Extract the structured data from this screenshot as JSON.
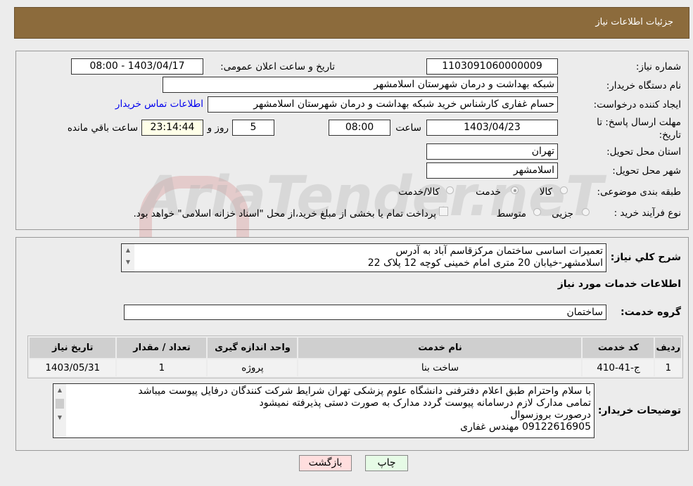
{
  "header": {
    "title": "جزئیات اطلاعات نیاز"
  },
  "form": {
    "need_number_label": "شماره نیاز:",
    "need_number": "1103091060000009",
    "announce_label": "تاریخ و ساعت اعلان عمومی:",
    "announce_value": "1403/04/17 - 08:00",
    "buyer_label": "نام دستگاه خریدار:",
    "buyer_value": "شبکه بهداشت و درمان شهرستان اسلامشهر",
    "creator_label": "ایجاد کننده درخواست:",
    "creator_value": "حسام غفاری کارشناس خرید شبکه بهداشت و درمان شهرستان اسلامشهر",
    "contact_link": "اطلاعات تماس خریدار",
    "deadline_label": "مهلت ارسال پاسخ: تا تاریخ:",
    "deadline_date": "1403/04/23",
    "time_label": "ساعت",
    "deadline_time": "08:00",
    "days": "5",
    "days_label": "روز و",
    "remaining": "23:14:44",
    "remaining_label": "ساعت باقي مانده",
    "province_label": "استان محل تحویل:",
    "province": "تهران",
    "city_label": "شهر محل تحویل:",
    "city": "اسلامشهر",
    "category_label": "طبقه بندی موضوعی:",
    "category_options": [
      "کالا",
      "خدمت",
      "کالا/خدمت"
    ],
    "category_selected": "خدمت",
    "process_label": "نوع فرآیند خرید :",
    "process_options": [
      "جزیی",
      "متوسط"
    ],
    "payment_note": "پرداخت تمام یا بخشی از مبلغ خرید،از محل \"اسناد خزانه اسلامی\" خواهد بود."
  },
  "details": {
    "summary_label": "شرح کلي نیاز:",
    "summary_lines": [
      "تعمیرات اساسی ساختمان مرکزقاسم آباد به آدرس",
      "اسلامشهر-خیابان 20 متری امام خمینی کوچه 12 پلاک 22"
    ],
    "services_title": "اطلاعات خدمات مورد نیاز",
    "group_label": "گروه خدمت:",
    "group_value": "ساختمان",
    "table": {
      "headers": [
        "ردیف",
        "کد خدمت",
        "نام خدمت",
        "واحد اندازه گیری",
        "تعداد / مقدار",
        "تاریخ نیاز"
      ],
      "rows": [
        [
          "1",
          "ج-41-410",
          "ساخت بنا",
          "پروژه",
          "1",
          "1403/05/31"
        ]
      ]
    },
    "buyer_notes_label": "توضیحات خریدار:",
    "buyer_notes_lines": [
      "با سلام واحترام طبق اعلام دفترفنی دانشگاه علوم پزشکی تهران شرایط شرکت کنندگان درفایل پیوست میباشد",
      "تمامی مدارک لازم درسامانه پیوست گردد مدارک به صورت دستی پذیرفته نمیشود",
      "درصورت بروزسوال",
      "09122616905 مهندس غفاری"
    ]
  },
  "buttons": {
    "print": "چاپ",
    "back": "بازگشت"
  },
  "watermark": "AriaTender.neT",
  "colors": {
    "header": "#8c6b3c",
    "link": "#0000ee",
    "remaining_bg": "#ffffe8",
    "back_bg": "#ffdede",
    "print_bg": "#e6fbe6"
  }
}
